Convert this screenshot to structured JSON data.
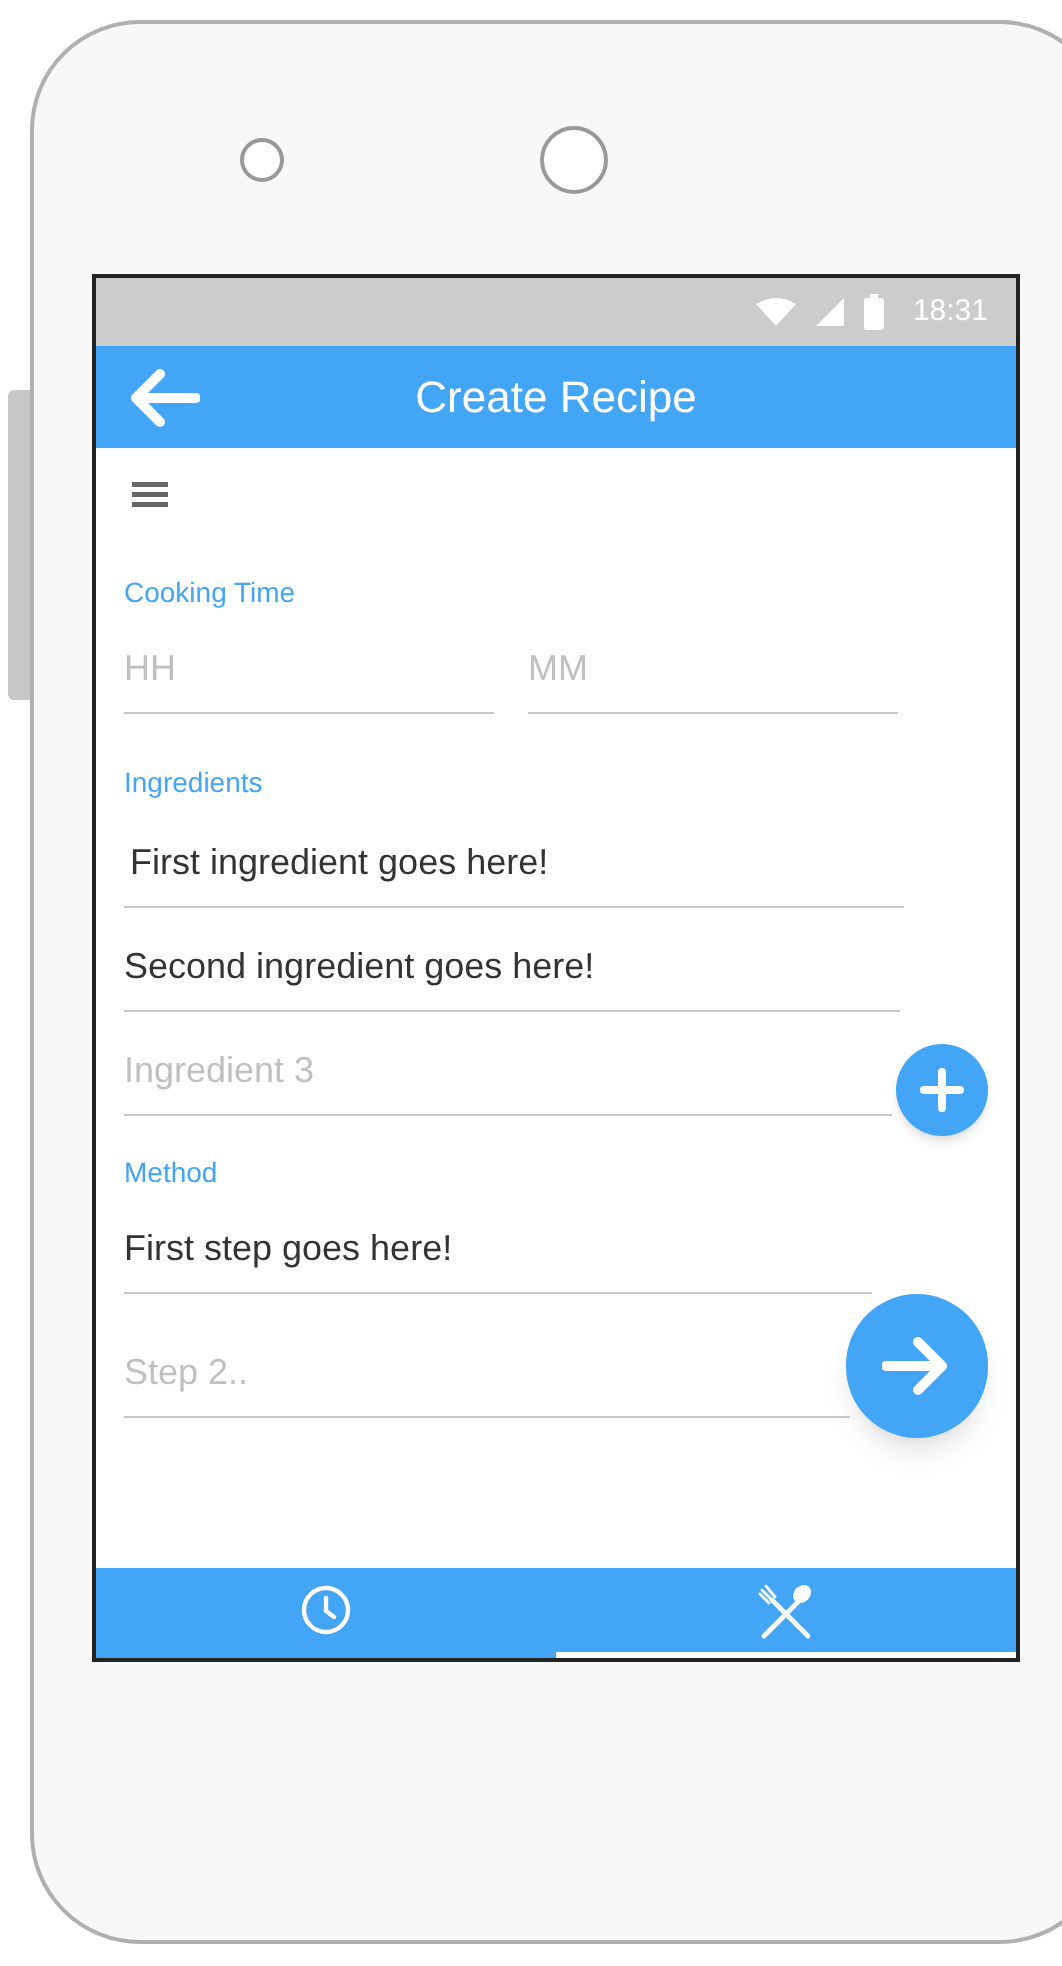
{
  "status_bar": {
    "time": "18:31"
  },
  "app_bar": {
    "title": "Create Recipe"
  },
  "cooking_time": {
    "label": "Cooking Time",
    "fields": [
      {
        "placeholder": "HH"
      },
      {
        "placeholder": "MM"
      }
    ]
  },
  "ingredients": {
    "label": "Ingredients",
    "fields": [
      {
        "value": "First ingredient goes here!"
      },
      {
        "value": "Second ingredient goes here!"
      },
      {
        "placeholder": "Ingredient 3"
      }
    ]
  },
  "method": {
    "label": "Method",
    "fields": [
      {
        "value": "First step goes here!"
      },
      {
        "placeholder": "Step 2.."
      }
    ]
  },
  "bottom_tabs": [
    {
      "kind": "clock",
      "selected": false
    },
    {
      "kind": "cutlery",
      "selected": true
    }
  ]
}
